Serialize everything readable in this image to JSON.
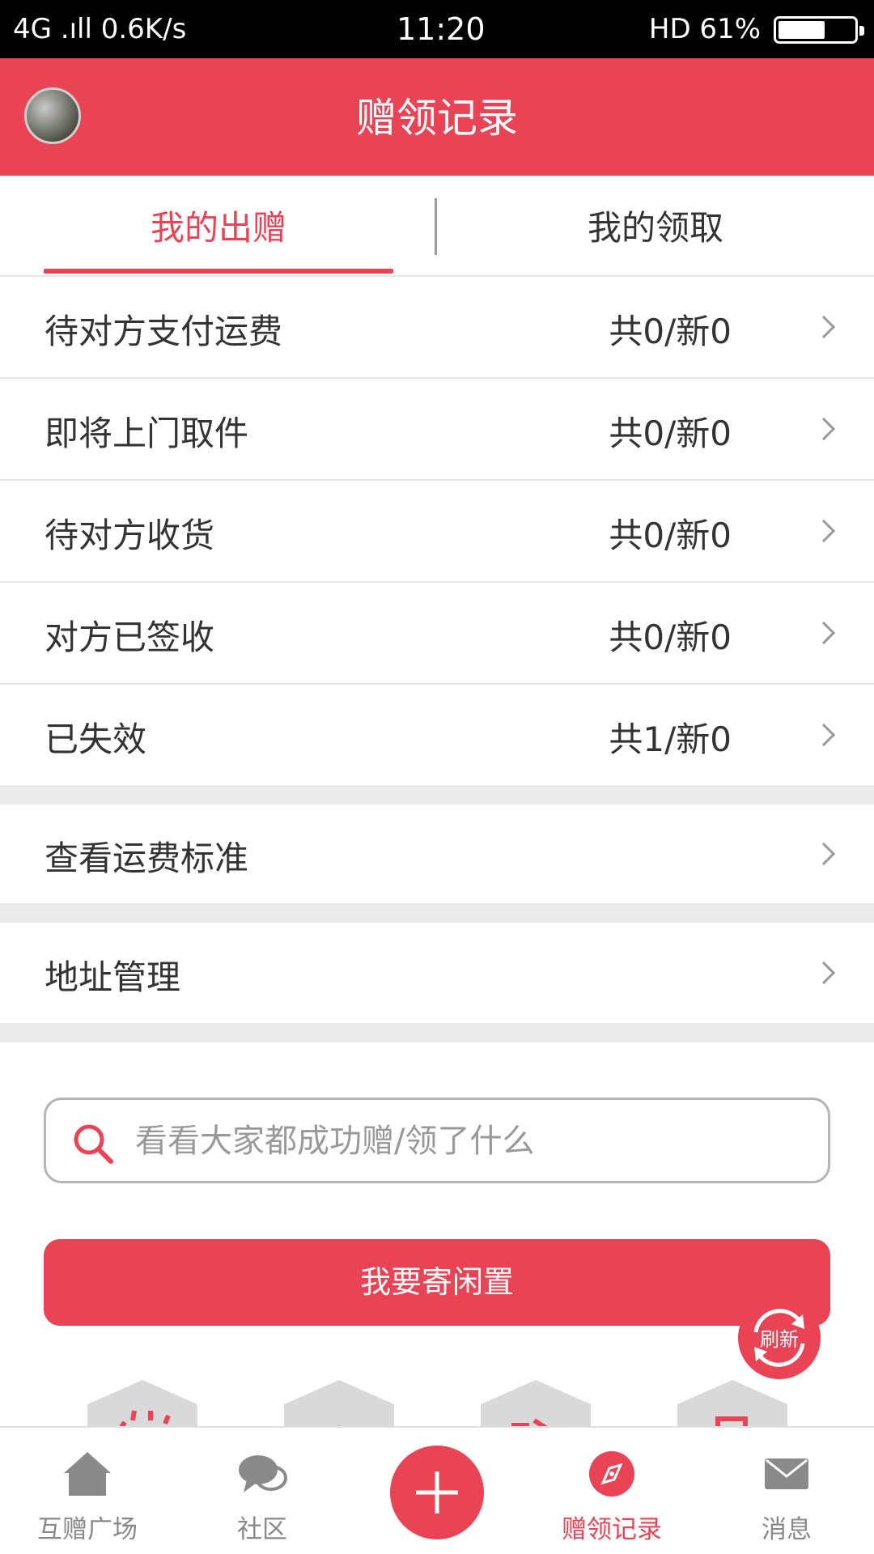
{
  "status_bar": {
    "left": "4G .ıll 0.6K/s",
    "time": "11:20",
    "right": "HD 61%"
  },
  "header": {
    "title": "赠领记录"
  },
  "tabs": [
    {
      "label": "我的出赠",
      "active": true
    },
    {
      "label": "我的领取",
      "active": false
    }
  ],
  "status_rows": [
    {
      "label": "待对方支付运费",
      "count": "共0/新0"
    },
    {
      "label": "即将上门取件",
      "count": "共0/新0"
    },
    {
      "label": "待对方收货",
      "count": "共0/新0"
    },
    {
      "label": "对方已签收",
      "count": "共0/新0"
    },
    {
      "label": "已失效",
      "count": "共1/新0"
    }
  ],
  "links": [
    {
      "label": "查看运费标准"
    },
    {
      "label": "地址管理"
    }
  ],
  "search": {
    "placeholder": "看看大家都成功赠/领了什么"
  },
  "primary_button": {
    "label": "我要寄闲置"
  },
  "refresh_button": {
    "label": "刷新"
  },
  "bottom_nav": [
    {
      "label": "互赠广场",
      "icon": "home-icon"
    },
    {
      "label": "社区",
      "icon": "chat-icon"
    },
    {
      "label": "",
      "icon": "plus-icon"
    },
    {
      "label": "赠领记录",
      "icon": "compass-icon",
      "active": true
    },
    {
      "label": "消息",
      "icon": "mail-icon"
    }
  ],
  "colors": {
    "accent": "#e84455",
    "status_bar": "#000000",
    "divider": "#ebebeb"
  }
}
